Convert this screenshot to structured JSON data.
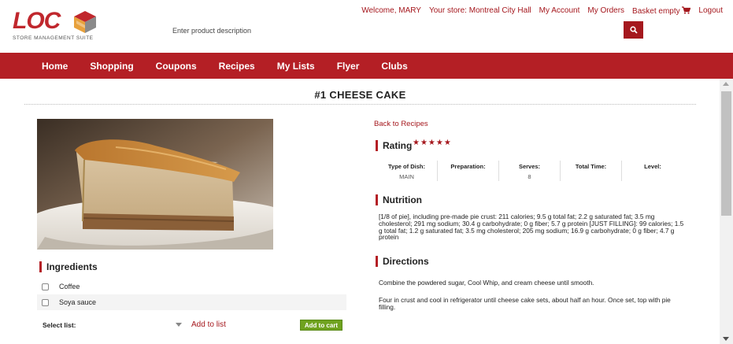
{
  "header": {
    "logo_text": "LOC",
    "logo_subtitle": "STORE MANAGEMENT SUITE",
    "search_placeholder": "Enter product description",
    "welcome": "Welcome, MARY",
    "store": "Your store: Montreal City Hall",
    "my_account": "My Account",
    "my_orders": "My Orders",
    "basket": "Basket empty",
    "logout": "Logout"
  },
  "nav": {
    "items": [
      "Home",
      "Shopping",
      "Coupons",
      "Recipes",
      "My Lists",
      "Flyer",
      "Clubs"
    ]
  },
  "recipe": {
    "title": "#1 CHEESE CAKE",
    "back_link": "Back to Recipes",
    "rating_label": "Rating",
    "rating_stars": "★★★★★",
    "rating_value": 5,
    "info": [
      {
        "label": "Type of Dish:",
        "value": "MAIN"
      },
      {
        "label": "Preparation:",
        "value": ""
      },
      {
        "label": "Serves:",
        "value": "8"
      },
      {
        "label": "Total Time:",
        "value": ""
      },
      {
        "label": "Level:",
        "value": ""
      }
    ],
    "nutrition_label": "Nutrition",
    "nutrition_text": "[1/8 of pie], including pre-made pie crust: 211 calories; 9.5 g total fat; 2.2 g saturated fat; 3.5 mg cholesterol; 291 mg sodium; 30.4 g carbohydrate; 0 g fiber; 5.7 g protein [JUST FILLING]: 99 calories; 1.5 g total fat; 1.2 g saturated fat; 3.5 mg cholesterol; 205 mg sodium; 16.9 g carbohydrate; 0 g fiber; 4.7 g protein",
    "directions_label": "Directions",
    "directions": [
      "Combine the powdered sugar, Cool Whip, and cream cheese until smooth.",
      "Four in crust and cool in refrigerator until cheese cake sets, about half an hour. Once set, top with pie filling."
    ],
    "ingredients_label": "Ingredients",
    "ingredients": [
      "Coffee",
      "Soya sauce"
    ],
    "select_list_label": "Select list:",
    "add_to_list": "Add to list",
    "add_to_cart": "Add to cart"
  },
  "colors": {
    "brand_red": "#b41f25",
    "link_red": "#a5181e",
    "cart_green": "#6fa21f"
  },
  "icons": {
    "search": "search-icon",
    "cart": "cart-icon",
    "scroll_up": "scroll-up-arrow-icon",
    "scroll_down": "scroll-down-arrow-icon"
  }
}
